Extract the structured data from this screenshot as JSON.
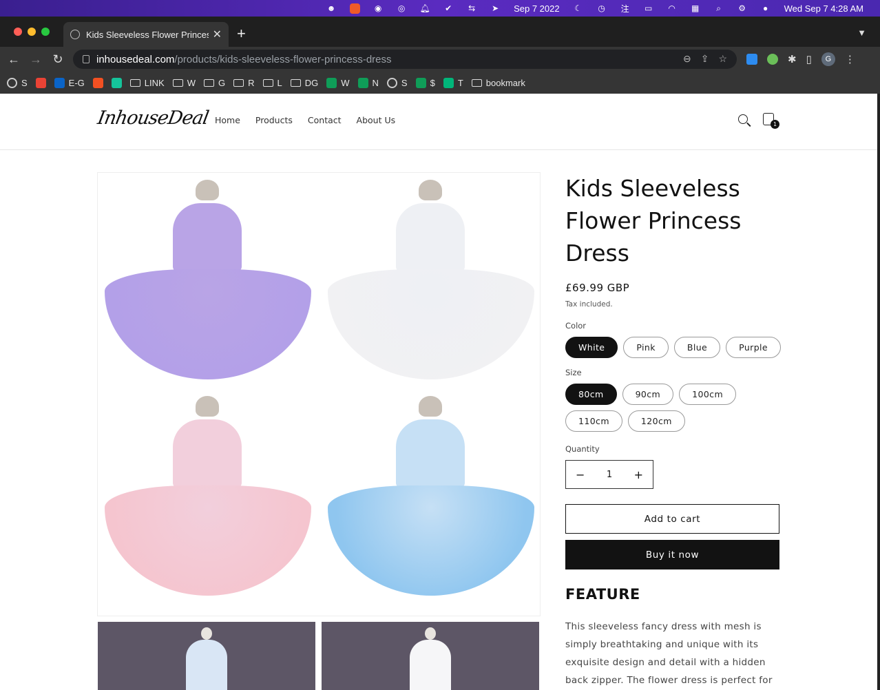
{
  "menubar": {
    "date_short": "Sep 7 2022",
    "clock": "Wed Sep 7  4:28 AM"
  },
  "browser": {
    "tab_title": "Kids Sleeveless Flower Princess Dress",
    "url_host": "inhousedeal.com",
    "url_path": "/products/kids-sleeveless-flower-princess-dress",
    "profile_initial": "G",
    "bookmarks": [
      {
        "label": "S",
        "icon": "globe-icon",
        "color": "#cccccc"
      },
      {
        "label": "",
        "icon": "gmail-icon",
        "color": "#ea4335"
      },
      {
        "label": "E-G",
        "icon": "outlook-icon",
        "color": "#0a64c8"
      },
      {
        "label": "",
        "icon": "microsoft-icon",
        "color": "#f25022"
      },
      {
        "label": "",
        "icon": "grammarly-icon",
        "color": "#15c39a"
      },
      {
        "label": "LINK",
        "icon": "folder-icon",
        "color": "#dddddd"
      },
      {
        "label": "W",
        "icon": "folder-icon",
        "color": "#dddddd"
      },
      {
        "label": "G",
        "icon": "folder-icon",
        "color": "#dddddd"
      },
      {
        "label": "R",
        "icon": "folder-icon",
        "color": "#dddddd"
      },
      {
        "label": "L",
        "icon": "folder-icon",
        "color": "#dddddd"
      },
      {
        "label": "DG",
        "icon": "folder-icon",
        "color": "#dddddd"
      },
      {
        "label": "W",
        "icon": "sheets-icon",
        "color": "#0f9d58"
      },
      {
        "label": "N",
        "icon": "sheets-icon",
        "color": "#0f9d58"
      },
      {
        "label": "S",
        "icon": "globe-icon",
        "color": "#cccccc"
      },
      {
        "label": "$",
        "icon": "sheets-icon",
        "color": "#0f9d58"
      },
      {
        "label": "T",
        "icon": "star-icon",
        "color": "#00b67a"
      },
      {
        "label": "bookmark",
        "icon": "folder-icon",
        "color": "#dddddd"
      }
    ]
  },
  "site": {
    "logo": "InhouseDeal",
    "nav": [
      "Home",
      "Products",
      "Contact",
      "About Us"
    ],
    "cart_count": "1"
  },
  "product": {
    "title": "Kids Sleeveless Flower Princess Dress",
    "price": "£69.99 GBP",
    "tax_note": "Tax included.",
    "color_label": "Color",
    "colors": [
      "White",
      "Pink",
      "Blue",
      "Purple"
    ],
    "selected_color": "White",
    "size_label": "Size",
    "sizes": [
      "80cm",
      "90cm",
      "100cm",
      "110cm",
      "120cm"
    ],
    "selected_size": "80cm",
    "quantity_label": "Quantity",
    "quantity": "1",
    "qty_minus": "−",
    "qty_plus": "+",
    "add_to_cart": "Add to cart",
    "buy_now": "Buy it now",
    "feature_heading": "FEATURE",
    "description": "This sleeveless fancy dress with mesh is simply breathtaking and unique with its exquisite design and detail with a hidden back zipper. The flower dress is perfect for birthday parties,",
    "gallery_colors": [
      {
        "name": "purple",
        "top": "#b9a4e6",
        "skirt": "#b3a0e8"
      },
      {
        "name": "white",
        "top": "#eef0f4",
        "skirt": "#f1f1f3"
      },
      {
        "name": "pink",
        "top": "#f2cfdc",
        "skirt": "#f5c5cf"
      },
      {
        "name": "blue",
        "top": "#c6e0f5",
        "skirt": "#8fc6ef"
      }
    ]
  }
}
